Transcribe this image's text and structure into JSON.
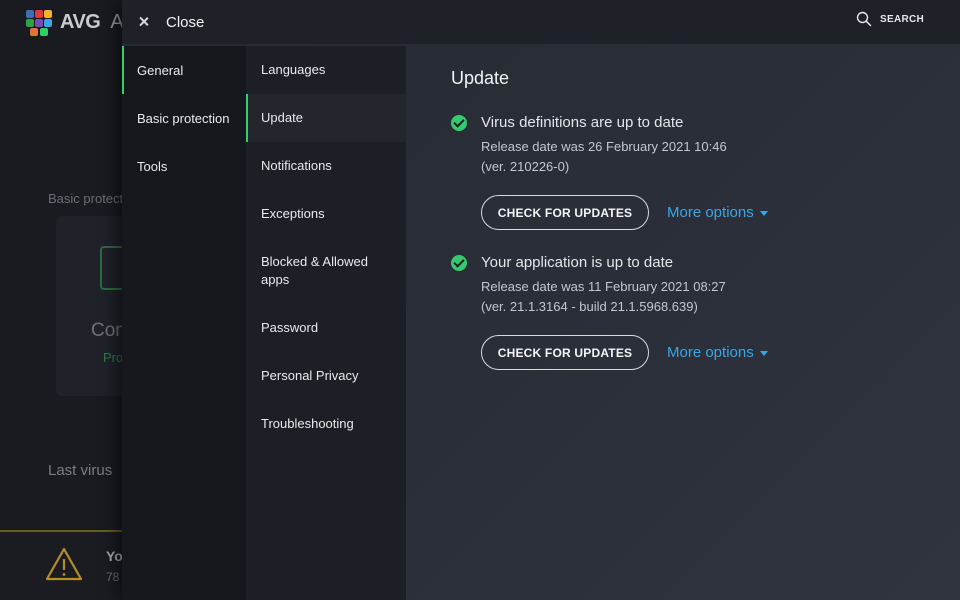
{
  "background": {
    "brand": "AVG",
    "brand_suffix": "An",
    "basic_protect_label": "Basic protect",
    "card_title": "Con",
    "card_status": "Pro",
    "last_virus": "Last virus",
    "bottom_title": "Yo",
    "bottom_sub": "78"
  },
  "topbar": {
    "close_label": "Close",
    "search_label": "SEARCH"
  },
  "categories": [
    {
      "label": "General",
      "active": true
    },
    {
      "label": "Basic protection",
      "active": false
    },
    {
      "label": "Tools",
      "active": false
    }
  ],
  "subnav": [
    {
      "label": "Languages"
    },
    {
      "label": "Update"
    },
    {
      "label": "Notifications"
    },
    {
      "label": "Exceptions"
    },
    {
      "label": "Blocked & Allowed apps"
    },
    {
      "label": "Password"
    },
    {
      "label": "Personal Privacy"
    },
    {
      "label": "Troubleshooting"
    }
  ],
  "content": {
    "title": "Update",
    "items": [
      {
        "status": "Virus definitions are up to date",
        "line1": "Release date was 26 February 2021 10:46",
        "line2": "(ver. 210226-0)",
        "button": "CHECK FOR UPDATES",
        "more": "More options"
      },
      {
        "status": "Your application is up to date",
        "line1": "Release date was 11 February 2021 08:27",
        "line2": "(ver. 21.1.3164 - build 21.1.5968.639)",
        "button": "CHECK FOR UPDATES",
        "more": "More options"
      }
    ]
  },
  "colors": {
    "accent_green": "#2fcf6c",
    "link_blue": "#3aa6e8",
    "check_green": "#37c870"
  }
}
